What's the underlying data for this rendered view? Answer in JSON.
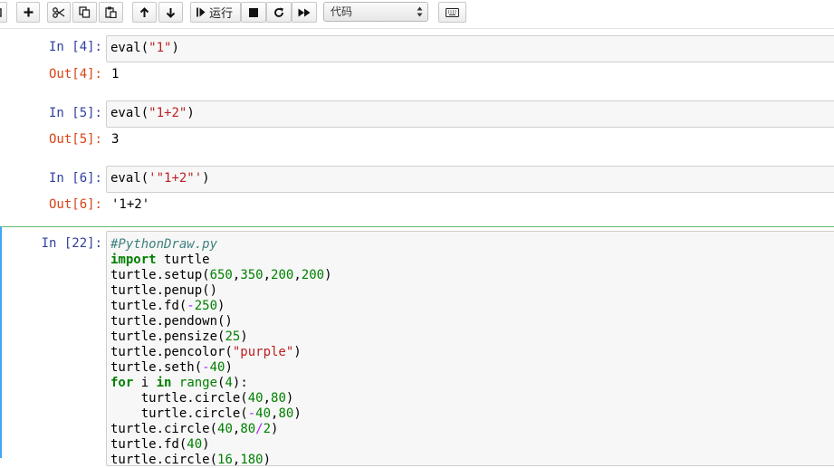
{
  "toolbar": {
    "run_label": "运行",
    "cell_type": "代码"
  },
  "cells": [
    {
      "in_prompt": "In [4]:",
      "code": "eval(\"1\")",
      "out_prompt": "Out[4]:",
      "output": "1"
    },
    {
      "in_prompt": "In [5]:",
      "code": "eval(\"1+2\")",
      "out_prompt": "Out[5]:",
      "output": "3"
    },
    {
      "in_prompt": "In [6]:",
      "code": "eval('\"1+2\"')",
      "out_prompt": "Out[6]:",
      "output": "'1+2'"
    },
    {
      "in_prompt": "In [22]:",
      "lines": [
        "#PythonDraw.py",
        "import turtle",
        "turtle.setup(650,350,200,200)",
        "turtle.penup()",
        "turtle.fd(-250)",
        "turtle.pendown()",
        "turtle.pensize(25)",
        "turtle.pencolor(\"purple\")",
        "turtle.seth(-40)",
        "for i in range(4):",
        "    turtle.circle(40,80)",
        "    turtle.circle(-40,80)",
        "turtle.circle(40,80/2)",
        "turtle.fd(40)",
        "turtle.circle(16,180)"
      ]
    }
  ],
  "colors": {
    "in_prompt": "#303f9f",
    "out_prompt": "#d84315",
    "string": "#ba2121",
    "keyword": "#008000",
    "comment": "#408080",
    "selected_border": "#66bb6a"
  }
}
